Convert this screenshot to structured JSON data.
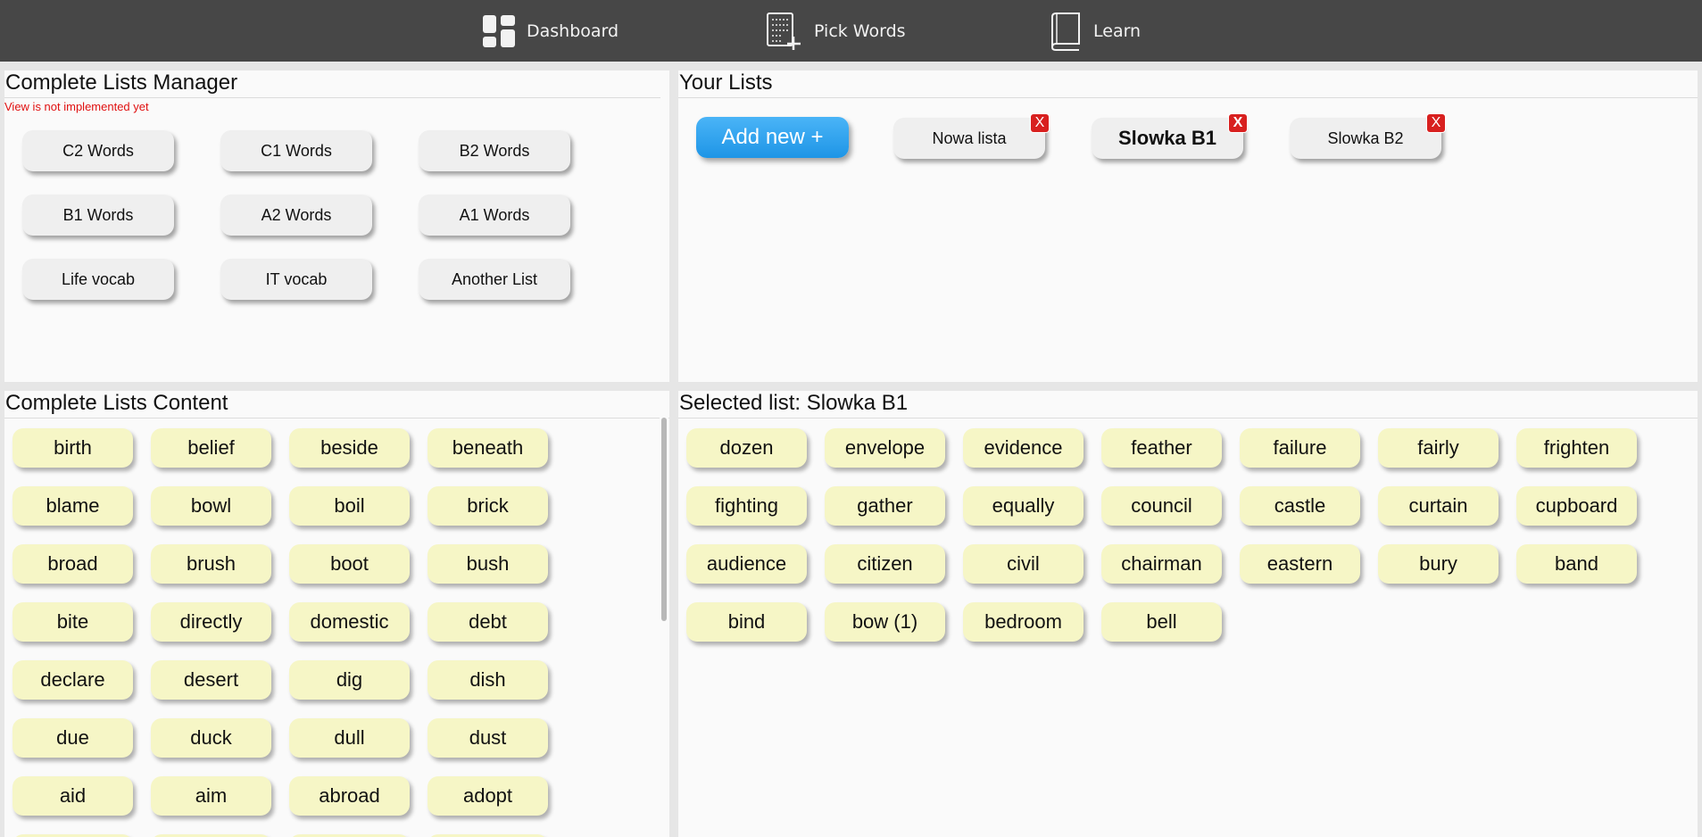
{
  "nav": {
    "dashboard": {
      "label": "Dashboard",
      "icon": "dashboard-icon"
    },
    "pick_words": {
      "label": "Pick Words",
      "icon": "pick-words-icon"
    },
    "learn": {
      "label": "Learn",
      "icon": "book-icon"
    }
  },
  "manager": {
    "title": "Complete Lists Manager",
    "warning": "View is not implemented yet",
    "lists": [
      "C2 Words",
      "C1 Words",
      "B2 Words",
      "B1 Words",
      "A2 Words",
      "A1 Words",
      "Life vocab",
      "IT vocab",
      "Another List"
    ]
  },
  "your_lists": {
    "title": "Your Lists",
    "add_label": "Add new +",
    "delete_label": "X",
    "lists": [
      {
        "label": "Nowa lista",
        "selected": false
      },
      {
        "label": "Slowka B1",
        "selected": true
      },
      {
        "label": "Slowka B2",
        "selected": false
      }
    ]
  },
  "content": {
    "title": "Complete Lists Content",
    "words": [
      "birth",
      "belief",
      "beside",
      "beneath",
      "blame",
      "bowl",
      "boil",
      "brick",
      "broad",
      "brush",
      "boot",
      "bush",
      "bite",
      "directly",
      "domestic",
      "debt",
      "declare",
      "desert",
      "dig",
      "dish",
      "due",
      "duck",
      "dull",
      "dust",
      "aid",
      "aim",
      "abroad",
      "adopt",
      "",
      "",
      "",
      ""
    ]
  },
  "selected": {
    "title": "Selected list: Slowka B1",
    "words": [
      "dozen",
      "envelope",
      "evidence",
      "feather",
      "failure",
      "fairly",
      "frighten",
      "fighting",
      "gather",
      "equally",
      "council",
      "castle",
      "curtain",
      "cupboard",
      "audience",
      "citizen",
      "civil",
      "chairman",
      "eastern",
      "bury",
      "band",
      "bind",
      "bow (1)",
      "bedroom",
      "bell"
    ]
  },
  "colors": {
    "topbar": "#474747",
    "chip": "#f6f6c6",
    "add_button": "#2ea3ee",
    "delete": "#d8201f",
    "warning": "#e01010"
  }
}
